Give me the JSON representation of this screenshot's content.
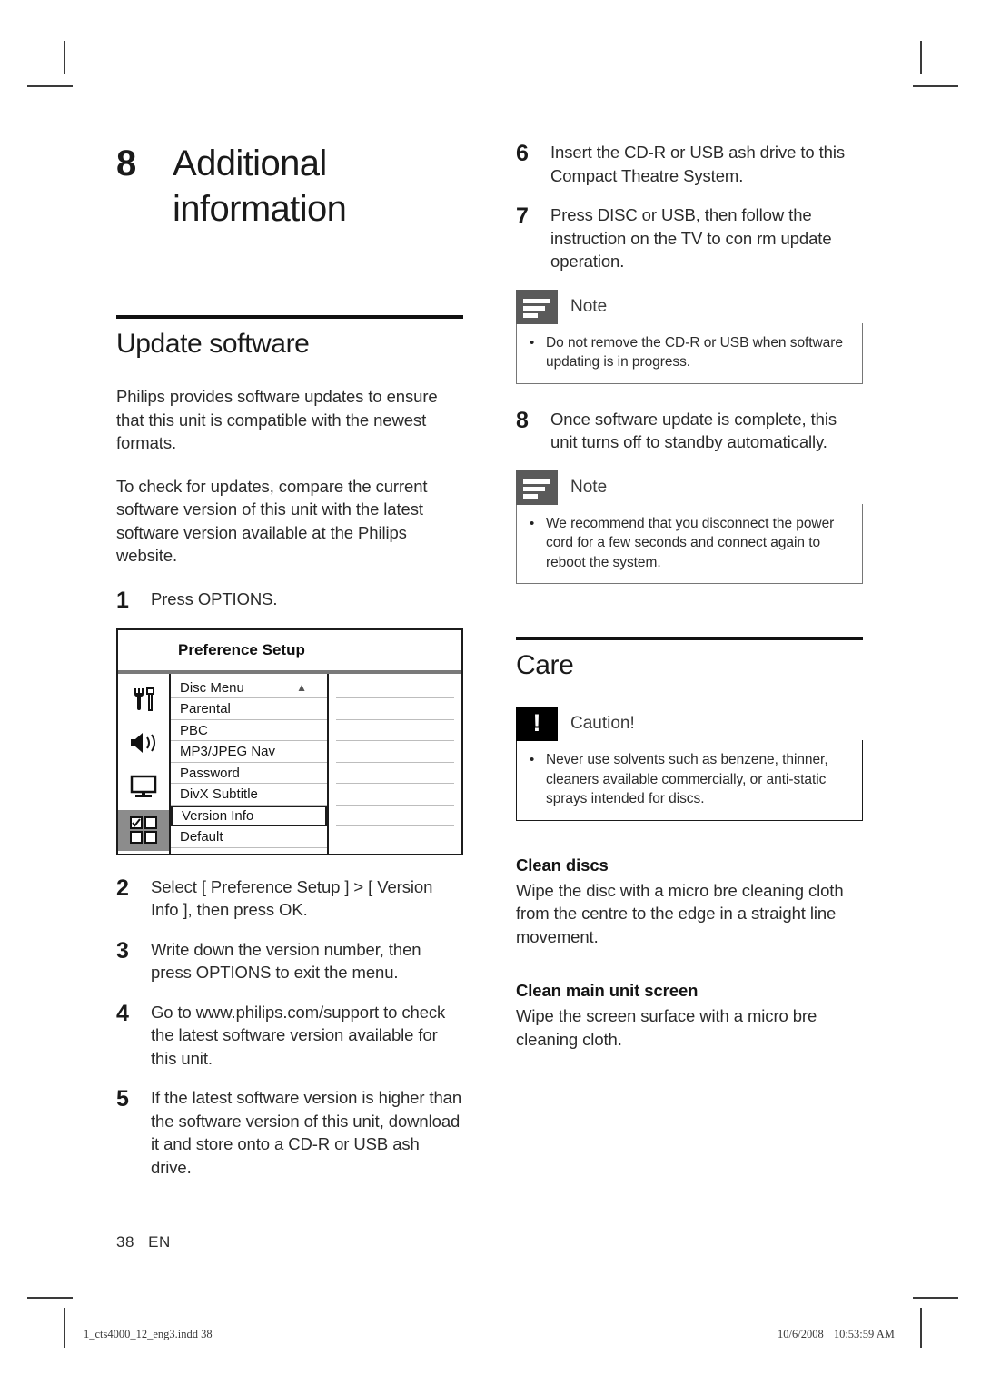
{
  "page": {
    "folio_number": "38",
    "folio_lang": "EN",
    "print_footer_file": "1_cts4000_12_eng3.indd   38",
    "print_footer_date": "10/6/2008",
    "print_footer_time": "10:53:59 AM"
  },
  "chapter": {
    "number": "8",
    "title": "Additional information"
  },
  "left_column": {
    "section_heading": "Update software",
    "intro_paragraph_1": "Philips provides software updates to ensure that this unit is compatible with the newest formats.",
    "intro_paragraph_2": "To check for updates, compare the current software version of this unit with the latest software version available at the Philips website.",
    "steps": [
      {
        "num": "1",
        "text": "Press OPTIONS."
      },
      {
        "num": "2",
        "text": "Select [ Preference Setup ] > [ Version Info ], then press OK."
      },
      {
        "num": "3",
        "text": "Write down the version number, then press OPTIONS to exit the menu."
      },
      {
        "num": "4",
        "text": "Go to www.philips.com/support to check the latest software version available for this unit."
      },
      {
        "num": "5",
        "text": "If the latest software version is higher than the software version of this unit, download it and store onto a CD-R or USB  ash drive."
      }
    ]
  },
  "osd_menu": {
    "title": "Preference Setup",
    "icons": [
      {
        "name": "tools-icon",
        "selected": false
      },
      {
        "name": "speaker-icon",
        "selected": false
      },
      {
        "name": "tv-icon",
        "selected": false
      },
      {
        "name": "preference-grid-icon",
        "selected": true
      }
    ],
    "rows": [
      {
        "label": "Disc Menu",
        "arrow": "▲",
        "highlighted": false
      },
      {
        "label": "Parental",
        "arrow": "",
        "highlighted": false
      },
      {
        "label": "PBC",
        "arrow": "",
        "highlighted": false
      },
      {
        "label": "MP3/JPEG Nav",
        "arrow": "",
        "highlighted": false
      },
      {
        "label": "Password",
        "arrow": "",
        "highlighted": false
      },
      {
        "label": "DivX Subtitle",
        "arrow": "",
        "highlighted": false
      },
      {
        "label": "Version Info",
        "arrow": "",
        "highlighted": true
      },
      {
        "label": "Default",
        "arrow": "",
        "highlighted": false
      }
    ]
  },
  "right_column": {
    "steps": [
      {
        "num": "6",
        "text": "Insert the CD-R or USB  ash drive to this Compact Theatre System."
      },
      {
        "num": "7",
        "text": "Press DISC or USB, then follow the instruction on the TV to con rm update operation."
      },
      {
        "num": "8",
        "text": "Once software update is complete, this unit turns off to standby automatically."
      }
    ],
    "note_1": {
      "label": "Note",
      "icon": "note-icon",
      "bullet": "Do not remove the CD-R or USB when software updating is in progress."
    },
    "note_2": {
      "label": "Note",
      "icon": "note-icon",
      "bullet": "We recommend that you disconnect the power cord for a few seconds and connect again to reboot the system."
    },
    "care_heading": "Care",
    "caution": {
      "label": "Caution!",
      "icon": "caution-icon",
      "glyph": "!",
      "bullet": "Never use solvents such as benzene, thinner, cleaners available commercially, or anti-static sprays intended for discs."
    },
    "clean_discs": {
      "heading": "Clean discs",
      "body": "Wipe the disc with a micro  bre cleaning cloth from the centre to the edge in a straight line movement."
    },
    "clean_screen": {
      "heading": "Clean main unit screen",
      "body": "Wipe the screen surface with a micro  bre cleaning cloth."
    }
  }
}
